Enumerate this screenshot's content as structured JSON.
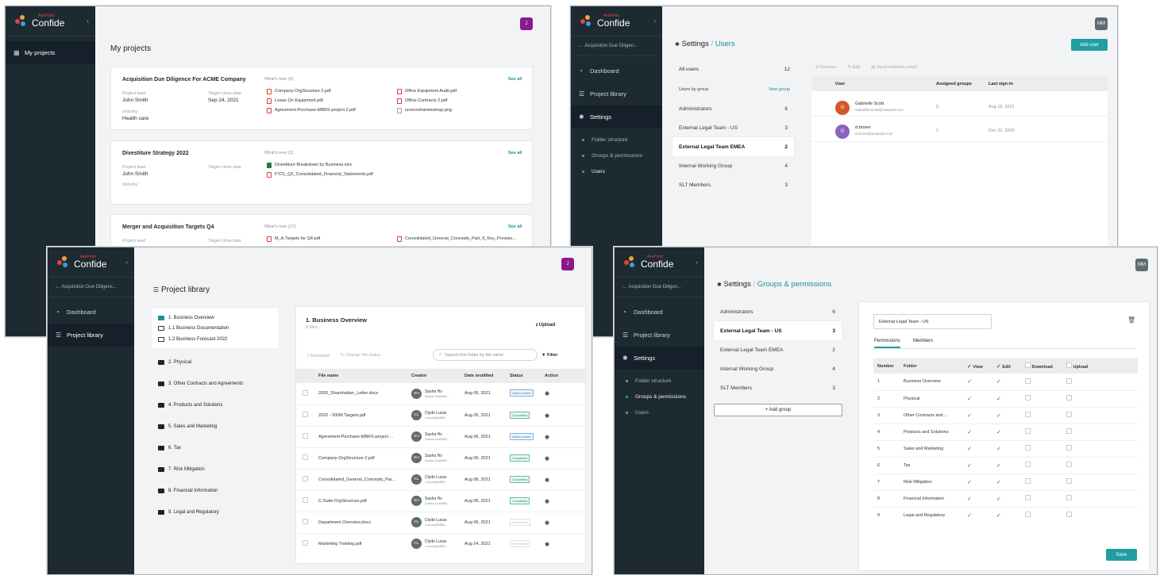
{
  "brand": {
    "small": "AvePoint",
    "name": "Confide"
  },
  "w1": {
    "avatar": "J",
    "nav": {
      "my_projects": "My projects"
    },
    "page_title": "My projects",
    "projects": [
      {
        "title": "Acquisition Due Diligence For ACME Company",
        "lead_label": "Project lead",
        "lead": "John Smith",
        "date_label": "Target close date",
        "date": "Sep 24, 2021",
        "industry_label": "Industry",
        "industry": "Health care",
        "whats_new": "What's new (6)",
        "see_all": "See all",
        "files_left": [
          "Company-OrgStructure 2.pdf",
          "Lease On Equipment.pdf",
          "Agreement-Purchase-MBRS-project 2.pdf"
        ],
        "files_right": [
          "Office Equipment Audit.pdf",
          "Office-Contracts 2.pdf",
          "screenshareteamsp.png"
        ]
      },
      {
        "title": "Divestiture Strategy 2022",
        "lead_label": "Project lead",
        "lead": "John Smith",
        "date_label": "Target close date",
        "date": "",
        "industry_label": "Industry",
        "industry": "",
        "whats_new": "What's new (2)",
        "see_all": "See all",
        "files_left": [
          "Divestiture Breakdown by Business.xlsx",
          "FY21_Q2_Consolidated_Financial_Statements.pdf"
        ],
        "files_right": []
      },
      {
        "title": "Merger and Acquisition Targets Q4",
        "lead_label": "Project lead",
        "lead": "",
        "date_label": "Target close date",
        "date": "",
        "industry_label": "",
        "industry": "",
        "whats_new": "What's new (17)",
        "see_all": "See all",
        "files_left": [
          "M_A-Targets for Q4.pdf"
        ],
        "files_right": [
          "Consolidated_General_Concepts_Part_II_Key_Provisio..."
        ]
      }
    ]
  },
  "w2": {
    "avatar": "MM",
    "back": "Acquisition Due Diligen...",
    "nav": [
      "Dashboard",
      "Project library",
      "Settings"
    ],
    "sub": [
      "Folder structure",
      "Groups & permissions",
      "Users"
    ],
    "crumb_a": "Settings",
    "crumb_b": "Users",
    "add_user": "Add user",
    "all_users": "All users",
    "all_users_count": "12",
    "by_group": "Users by group",
    "new_group": "New group",
    "groups": [
      {
        "name": "Administrators",
        "count": "6"
      },
      {
        "name": "External Legal Team - US",
        "count": "3"
      },
      {
        "name": "External Legal Team EMEA",
        "count": "2"
      },
      {
        "name": "Internal Working Group",
        "count": "4"
      },
      {
        "name": "SLT Members",
        "count": "3"
      }
    ],
    "toolbar": {
      "remove": "Remove",
      "edit": "Edit",
      "send": "Send invitation email"
    },
    "cols": {
      "user": "User",
      "groups": "Assigned groups",
      "last": "Last sign-in"
    },
    "users": [
      {
        "initial": "G",
        "name": "Gabrielle Scott",
        "email": "Gabrielle.Scott@avepoint.com",
        "groups": "5",
        "last": "Aug 18, 2021",
        "color": "#d4582a"
      },
      {
        "initial": "D",
        "name": "d.brown",
        "email": "d.brown@avepoint.com",
        "groups": "1",
        "last": "Dec 31, 2000",
        "color": "#8c62bd"
      }
    ]
  },
  "w3": {
    "avatar": "J",
    "back": "Acquisition Due Diligenc...",
    "nav": [
      "Dashboard",
      "Project library"
    ],
    "page_title": "Project library",
    "tree_open": "1. Business Overview",
    "tree_children": [
      "1.1 Business Documentation",
      "1.2 Business Forecast 2022"
    ],
    "tree": [
      "2. Physical",
      "3. Other Contracts and Agreements",
      "4. Products and Solutions",
      "5. Sales and Marketing",
      "6. Tax",
      "7. Risk Mitigation",
      "8. Financial Information",
      "9. Legal and Regulatory"
    ],
    "panel_title": "1. Business Overview",
    "panel_sub": "8 files",
    "upload": "Upload",
    "download": "Download",
    "change_status": "Change file status",
    "search_placeholder": "Search this folder by file name",
    "filter": "Filter",
    "cols": {
      "name": "File name",
      "creator": "Creator",
      "date": "Date modified",
      "status": "Status",
      "action": "Action"
    },
    "files": [
      {
        "name": "2020_Shareholder_Letter.docx",
        "ci": "SH",
        "cname": "Sasha Ho",
        "cemail": "Sasha.Ho@MB...",
        "date": "Aug 06, 2021",
        "status": "Under review",
        "st": "review"
      },
      {
        "name": "2022 - 500M Targets.pdf",
        "ci": "CL",
        "cname": "Clyde Lucas",
        "cemail": "c.lucas@MBR...",
        "date": "Aug 06, 2021",
        "status": "Completed",
        "st": "done"
      },
      {
        "name": "Agreement-Purchase-MBRS-project ...",
        "ci": "SH",
        "cname": "Sasha Ho",
        "cemail": "Sasha.Ho@MB...",
        "date": "Aug 06, 2021",
        "status": "Under review",
        "st": "review"
      },
      {
        "name": "Company-OrgStructure 2.pdf",
        "ci": "SH",
        "cname": "Sasha Ho",
        "cemail": "Sasha.Ho@MB...",
        "date": "Aug 06, 2021",
        "status": "Completed",
        "st": "done"
      },
      {
        "name": "Consolidated_General_Concepts_Par...",
        "ci": "CL",
        "cname": "Clyde Lucas",
        "cemail": "c.lucas@MBR...",
        "date": "Aug 06, 2021",
        "status": "Completed",
        "st": "done"
      },
      {
        "name": "C-Suite-OrgStructure.pdf",
        "ci": "SH",
        "cname": "Sasha Ho",
        "cemail": "Sasha.Ho@MB...",
        "date": "Aug 06, 2021",
        "status": "Completed",
        "st": "done"
      },
      {
        "name": "Department Overview.docx",
        "ci": "CL",
        "cname": "Clyde Lucas",
        "cemail": "c.lucas@MBR...",
        "date": "Aug 06, 2021",
        "status": "Not started",
        "st": "none"
      },
      {
        "name": "Marketing Training.pdf",
        "ci": "CL",
        "cname": "Clyde Lucas",
        "cemail": "c.lucas@MBR...",
        "date": "Aug 24, 2021",
        "status": "Not started",
        "st": "none"
      }
    ]
  },
  "w4": {
    "avatar": "MM",
    "back": "Acquisition Due Diligen...",
    "nav": [
      "Dashboard",
      "Project library",
      "Settings"
    ],
    "sub": [
      "Folder structure",
      "Groups & permissions",
      "Users"
    ],
    "crumb_a": "Settings",
    "crumb_b": "Groups & permissions",
    "groups": [
      {
        "name": "Administrators",
        "count": "6"
      },
      {
        "name": "External Legal Team - US",
        "count": "3"
      },
      {
        "name": "External Legal Team EMEA",
        "count": "2"
      },
      {
        "name": "Internal Working Group",
        "count": "4"
      },
      {
        "name": "SLT Members",
        "count": "3"
      }
    ],
    "add_group": "+ Add group",
    "group_name_value": "External Legal Team - US",
    "tabs": [
      "Permissions",
      "Members"
    ],
    "cols": {
      "num": "Number",
      "folder": "Folder",
      "view": "View",
      "edit": "Edit",
      "download": "Download",
      "upload": "Upload"
    },
    "rows": [
      {
        "n": "1",
        "f": "Business Overview"
      },
      {
        "n": "2",
        "f": "Physical"
      },
      {
        "n": "3",
        "f": "Other Contracts and ..."
      },
      {
        "n": "4",
        "f": "Products and Solutions"
      },
      {
        "n": "5",
        "f": "Sales and Marketing"
      },
      {
        "n": "6",
        "f": "Tax"
      },
      {
        "n": "7",
        "f": "Risk Mitigation"
      },
      {
        "n": "8",
        "f": "Financial Information"
      },
      {
        "n": "9",
        "f": "Legal and Regulatory"
      }
    ],
    "save": "Save"
  },
  "colors": {
    "sidebar": "#1e2a31",
    "teal": "#1f9ea4",
    "avatar_j": "#8a1a8c",
    "avatar_mm": "#5f6b73"
  }
}
